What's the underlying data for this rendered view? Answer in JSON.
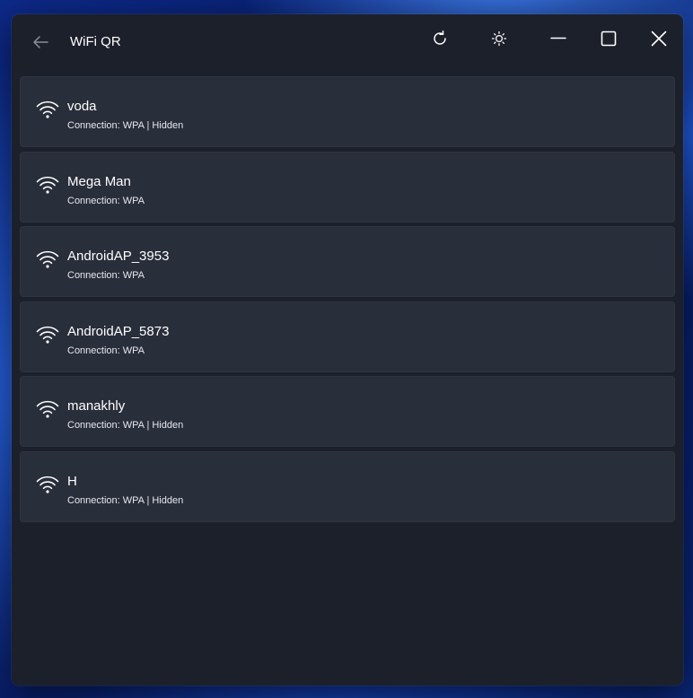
{
  "window": {
    "title": "WiFi QR"
  },
  "titlebar": {
    "back_icon": "back-arrow-icon",
    "refresh_icon": "refresh-icon",
    "theme_icon": "sun-icon",
    "minimize_icon": "minimize-icon",
    "maximize_icon": "maximize-icon",
    "close_icon": "close-icon"
  },
  "networks": [
    {
      "name": "voda",
      "connection": "Connection: WPA | Hidden"
    },
    {
      "name": "Mega Man",
      "connection": "Connection: WPA"
    },
    {
      "name": "AndroidAP_3953",
      "connection": "Connection: WPA"
    },
    {
      "name": "AndroidAP_5873",
      "connection": "Connection: WPA"
    },
    {
      "name": "manakhly",
      "connection": "Connection: WPA | Hidden"
    },
    {
      "name": "H",
      "connection": "Connection: WPA | Hidden"
    }
  ],
  "colors": {
    "window_bg": "#1c202b",
    "card_bg": "#292e3b",
    "text_primary": "#ffffff"
  }
}
